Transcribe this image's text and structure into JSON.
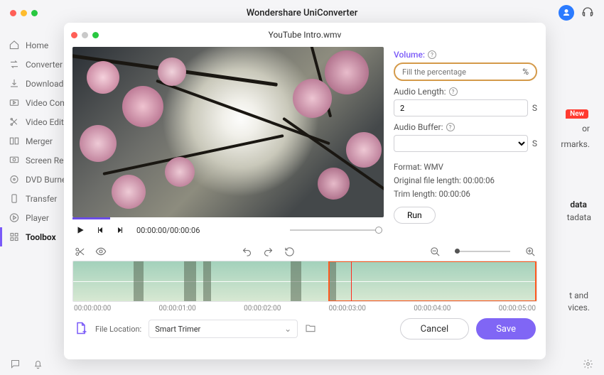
{
  "app": {
    "title": "Wondershare UniConverter"
  },
  "sidebar": {
    "items": [
      {
        "label": "Home"
      },
      {
        "label": "Converter"
      },
      {
        "label": "Downloader"
      },
      {
        "label": "Video Compressor"
      },
      {
        "label": "Video Editor"
      },
      {
        "label": "Merger"
      },
      {
        "label": "Screen Recorder"
      },
      {
        "label": "DVD Burner"
      },
      {
        "label": "Transfer"
      },
      {
        "label": "Player"
      },
      {
        "label": "Toolbox"
      }
    ],
    "active_index": 10
  },
  "dialog": {
    "title": "YouTube Intro.wmv",
    "timecode": "00:00:00/00:00:06",
    "ruler": [
      "00:00:00:00",
      "00:00:01:00",
      "00:00:02:00",
      "00:00:03:00",
      "00:00:04:00",
      "00:00:05:00"
    ],
    "file_location_label": "File Location:",
    "file_location_value": "Smart Trimer",
    "cancel": "Cancel",
    "save": "Save"
  },
  "panel": {
    "volume_label": "Volume:",
    "volume_placeholder": "Fill the percentage",
    "volume_unit": "%",
    "audio_length_label": "Audio Length:",
    "audio_length_value": "2",
    "audio_length_unit": "S",
    "audio_buffer_label": "Audio Buffer:",
    "audio_buffer_unit": "S",
    "format_line": "Format: WMV",
    "orig_length_line": "Original file length: 00:00:06",
    "trim_length_line": "Trim length: 00:00:06",
    "run": "Run"
  },
  "background": {
    "new_badge": "New",
    "or_text": "or",
    "marks": "rmarks.",
    "data": "data",
    "tadata": "tadata",
    "tand": "t and",
    "vices": "vices."
  }
}
